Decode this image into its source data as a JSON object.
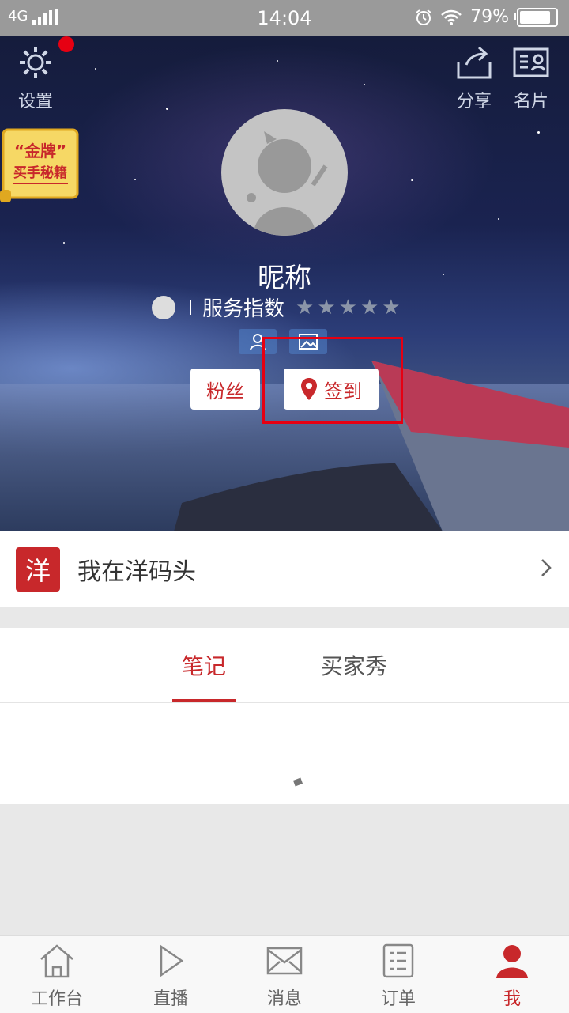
{
  "status": {
    "network": "4G",
    "time": "14:04",
    "battery": "79%"
  },
  "header": {
    "settings_label": "设置",
    "share_label": "分享",
    "card_label": "名片"
  },
  "badge": {
    "line1": "“金牌”",
    "line2": "买手秘籍"
  },
  "profile": {
    "nickname": "昵称",
    "service_label": "服务指数",
    "rating": 0,
    "max_rating": 5
  },
  "actions": {
    "fans_label": "粉丝",
    "checkin_label": "签到"
  },
  "store_row": {
    "logo_text": "洋",
    "label": "我在洋码头"
  },
  "tabs": [
    {
      "label": "笔记",
      "active": true
    },
    {
      "label": "买家秀",
      "active": false
    }
  ],
  "nav": [
    {
      "label": "工作台",
      "icon": "home-icon"
    },
    {
      "label": "直播",
      "icon": "play-icon"
    },
    {
      "label": "消息",
      "icon": "mail-icon"
    },
    {
      "label": "订单",
      "icon": "list-icon"
    },
    {
      "label": "我",
      "icon": "person-icon",
      "active": true
    }
  ],
  "colors": {
    "accent": "#c8282b",
    "highlight": "#e60012"
  }
}
